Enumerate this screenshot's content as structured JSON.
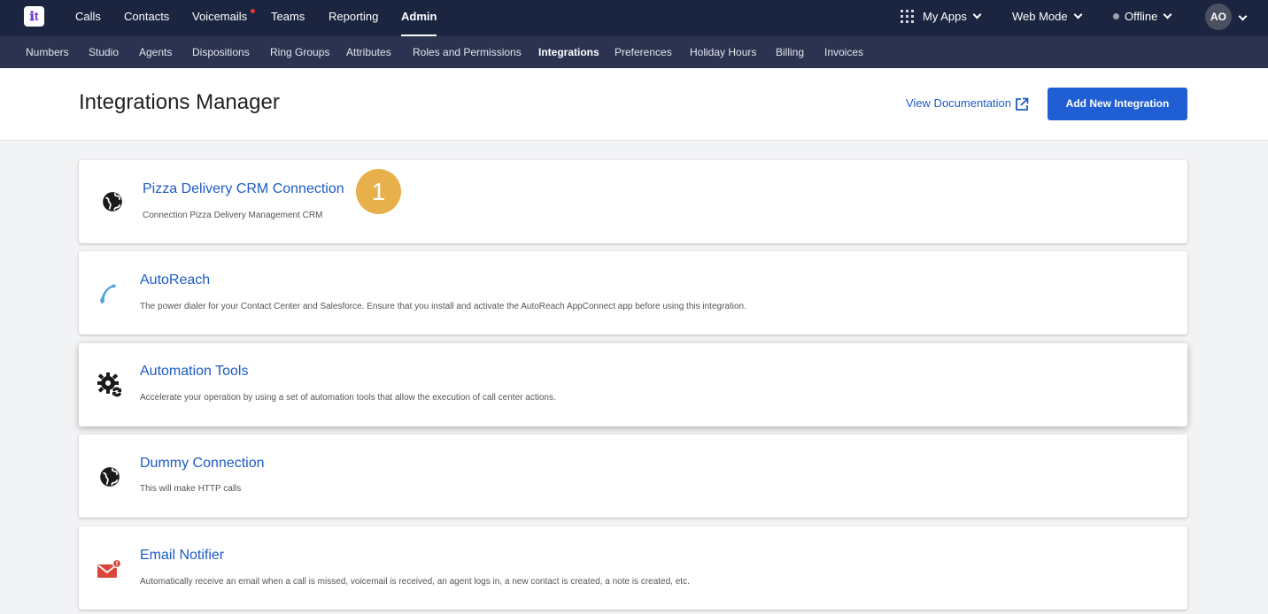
{
  "topnav": {
    "logo_text": "ℹt",
    "items": [
      "Calls",
      "Contacts",
      "Voicemails",
      "Teams",
      "Reporting",
      "Admin"
    ],
    "active": "Admin",
    "my_apps": "My Apps",
    "web_mode": "Web Mode",
    "status": "Offline",
    "avatar_initials": "AO"
  },
  "subnav": {
    "items": [
      "Numbers",
      "Studio",
      "Agents",
      "Dispositions",
      "Ring Groups",
      "Attributes",
      "Roles and Permissions",
      "Integrations",
      "Preferences",
      "Holiday Hours",
      "Billing",
      "Invoices"
    ],
    "active": "Integrations"
  },
  "header": {
    "title": "Integrations Manager",
    "doc_link": "View Documentation",
    "add_button": "Add New Integration"
  },
  "integrations": [
    {
      "title": "Pizza Delivery CRM Connection",
      "description": "Connection Pizza Delivery Management CRM",
      "icon": "globe-icon"
    },
    {
      "title": "AutoReach",
      "description": "The power dialer for your Contact Center and Salesforce. Ensure that you install and activate the AutoReach AppConnect app before using this integration.",
      "icon": "phone-icon"
    },
    {
      "title": "Automation Tools",
      "description": "Accelerate your operation by using a set of automation tools that allow the execution of call center actions.",
      "icon": "gear-sync-icon"
    },
    {
      "title": "Dummy Connection",
      "description": "This will make HTTP calls",
      "icon": "globe-icon"
    },
    {
      "title": "Email Notifier",
      "description": "Automatically receive an email when a call is missed, voicemail is received, an agent logs in, a new contact is created, a note is created, etc.",
      "icon": "email-alert-icon"
    }
  ],
  "step_badge": "1",
  "colors": {
    "topnav_bg": "#1c2540",
    "subnav_bg": "#2b3350",
    "accent": "#1f5fd3",
    "link": "#1e5bc6",
    "badge": "#e8b04a"
  }
}
